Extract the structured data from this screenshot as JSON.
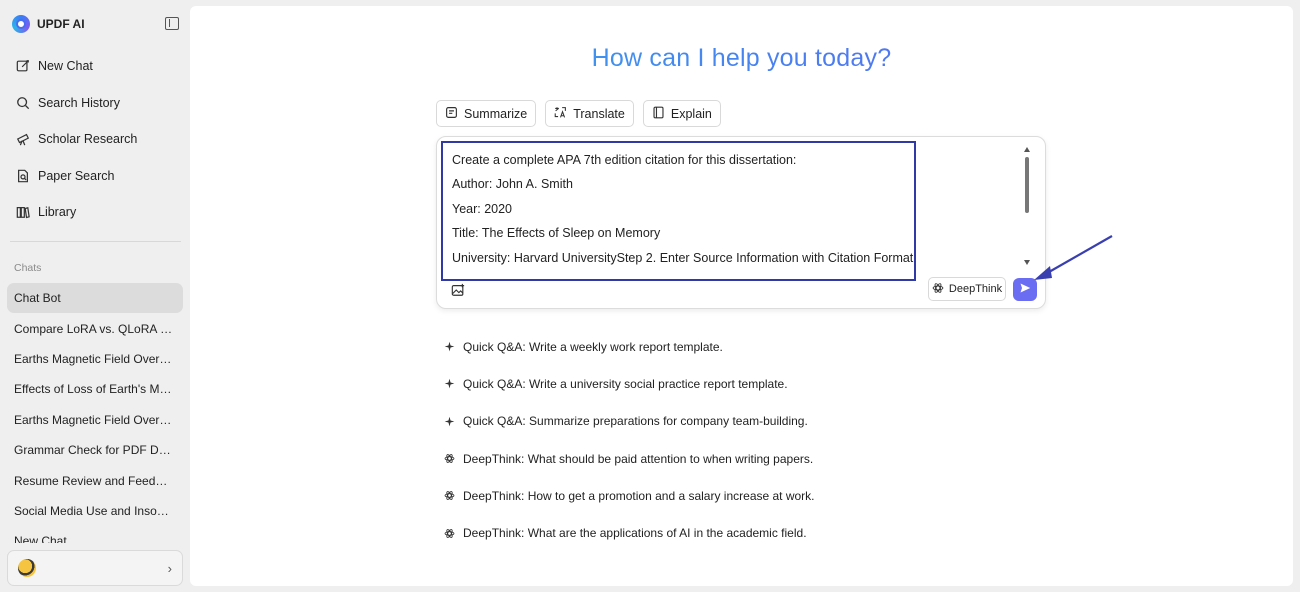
{
  "brand": {
    "name": "UPDF AI"
  },
  "sidebar": {
    "nav": [
      {
        "label": "New Chat",
        "icon": "edit-icon"
      },
      {
        "label": "Search History",
        "icon": "search-icon"
      },
      {
        "label": "Scholar Research",
        "icon": "telescope-icon"
      },
      {
        "label": "Paper Search",
        "icon": "paper-search-icon"
      },
      {
        "label": "Library",
        "icon": "library-icon"
      }
    ],
    "chats_label": "Chats",
    "chats": [
      "Chat Bot",
      "Compare LoRA vs. QLoRA for...",
      "Earths Magnetic Field Overvi...",
      "Effects of Loss of Earth's Mag...",
      "Earths Magnetic Field Overvi...",
      "Grammar Check for PDF Doc...",
      "Resume Review and Feedback",
      "Social Media Use and Insomn...",
      "New Chat"
    ],
    "active_chat": "Chat Bot"
  },
  "main": {
    "headline": "How can I help you today?",
    "actions": [
      {
        "label": "Summarize",
        "icon": "summarize-icon"
      },
      {
        "label": "Translate",
        "icon": "translate-icon"
      },
      {
        "label": "Explain",
        "icon": "book-icon"
      }
    ],
    "prompt_lines": [
      "Create a complete APA 7th edition citation for this dissertation:",
      "Author: John A. Smith",
      "Year: 2020",
      "Title: The Effects of Sleep on Memory",
      "University: Harvard UniversityStep 2. Enter Source Information with Citation Format"
    ],
    "deepthink_label": "DeepThink",
    "suggestions": [
      {
        "type": "sparkle",
        "text": "Quick Q&A: Write a weekly work report template."
      },
      {
        "type": "sparkle",
        "text": "Quick Q&A: Write a university social practice report template."
      },
      {
        "type": "sparkle",
        "text": "Quick Q&A: Summarize preparations for company team-building."
      },
      {
        "type": "atom",
        "text": "DeepThink: What should be paid attention to when writing papers."
      },
      {
        "type": "atom",
        "text": "DeepThink: How to get a promotion and a salary increase at work."
      },
      {
        "type": "atom",
        "text": "DeepThink: What are the applications of AI in the academic field."
      }
    ]
  },
  "colors": {
    "accent": "#6a6cf2",
    "highlight_box": "#2f3aa6",
    "annotation_arrow": "#3a3fb0",
    "headline_gradient_start": "#2eb6e8",
    "headline_gradient_end": "#6a5ce6"
  }
}
